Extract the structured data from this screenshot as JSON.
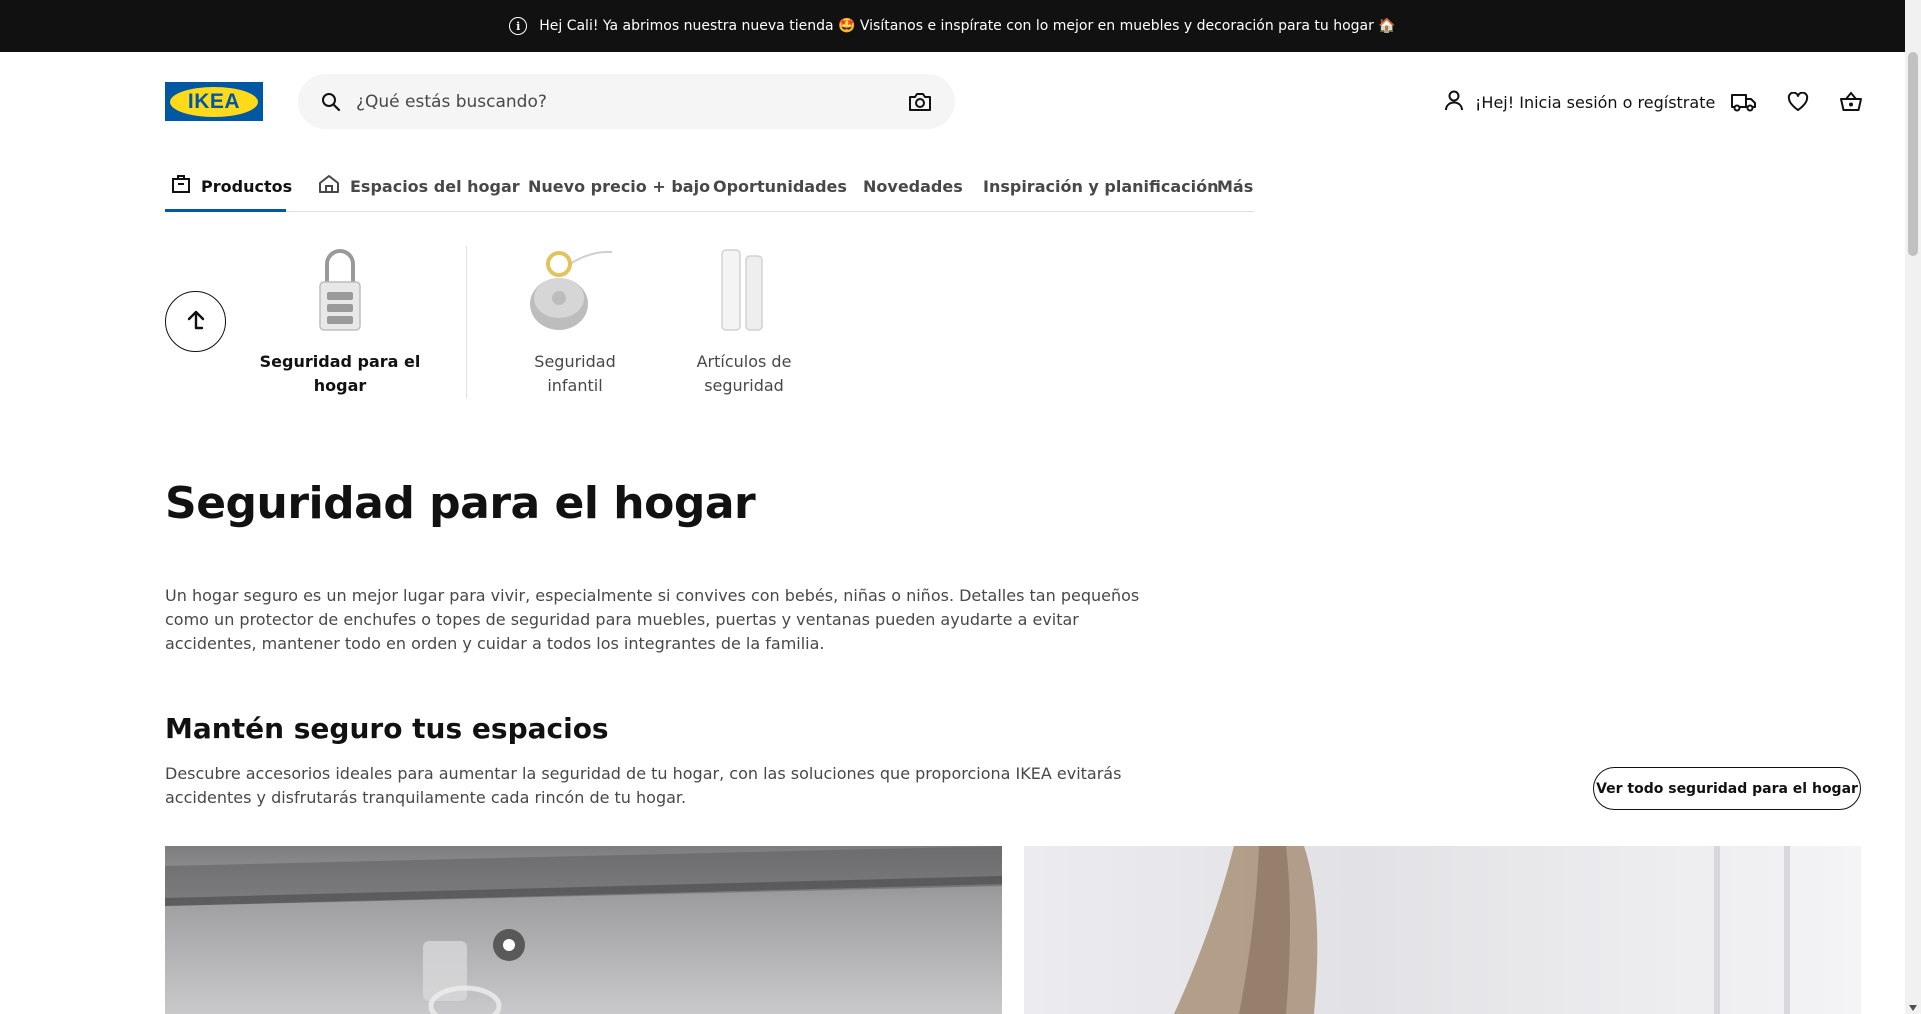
{
  "banner": {
    "text": "Hej Cali! Ya abrimos nuestra nueva tienda 🤩 Visítanos e inspírate con lo mejor en muebles y decoración para tu hogar 🏠",
    "icon": "info-icon"
  },
  "header": {
    "logo_text": "IKEA",
    "search_placeholder": "¿Qué estás buscando?",
    "login_label": "¡Hej! Inicia sesión o regístrate",
    "icons": [
      "user-icon",
      "truck-icon",
      "heart-icon",
      "basket-icon",
      "search-icon",
      "camera-icon"
    ]
  },
  "nav": {
    "items": [
      {
        "label": "Productos",
        "icon": "box-icon",
        "active": true
      },
      {
        "label": "Espacios del hogar",
        "icon": "home-icon",
        "active": false
      },
      {
        "label": "Nuevo precio + bajo",
        "active": false
      },
      {
        "label": "Oportunidades",
        "active": false
      },
      {
        "label": "Novedades",
        "active": false
      },
      {
        "label": "Inspiración y planificación",
        "active": false
      },
      {
        "label": "Más",
        "active": false
      }
    ]
  },
  "categories": [
    {
      "label": "Seguridad para el hogar",
      "active": true,
      "icon": "padlock-icon"
    },
    {
      "label": "Seguridad infantil",
      "active": false,
      "icon": "child-safety-icon"
    },
    {
      "label": "Artículos de seguridad",
      "active": false,
      "icon": "door-sensor-icon"
    }
  ],
  "page": {
    "title": "Seguridad para el hogar",
    "intro": "Un hogar seguro es un mejor lugar para vivir, especialmente si convives con bebés, niñas o niños. Detalles tan pequeños como un protector de enchufes o topes de seguridad para muebles, puertas y ventanas pueden ayudarte a evitar accidentes, mantener todo en orden y cuidar a todos los integrantes de la familia.",
    "section_title": "Mantén seguro tus espacios",
    "section_desc": "Descubre accesorios ideales para aumentar la seguridad de tu hogar, con las soluciones que proporciona IKEA evitarás accidentes y disfrutarás tranquilamente cada rincón de tu hogar.",
    "see_all_label": "Ver todo seguridad para el hogar"
  },
  "colors": {
    "brand_blue": "#0058a3",
    "brand_yellow": "#ffda1a",
    "banner_bg": "#111111"
  }
}
